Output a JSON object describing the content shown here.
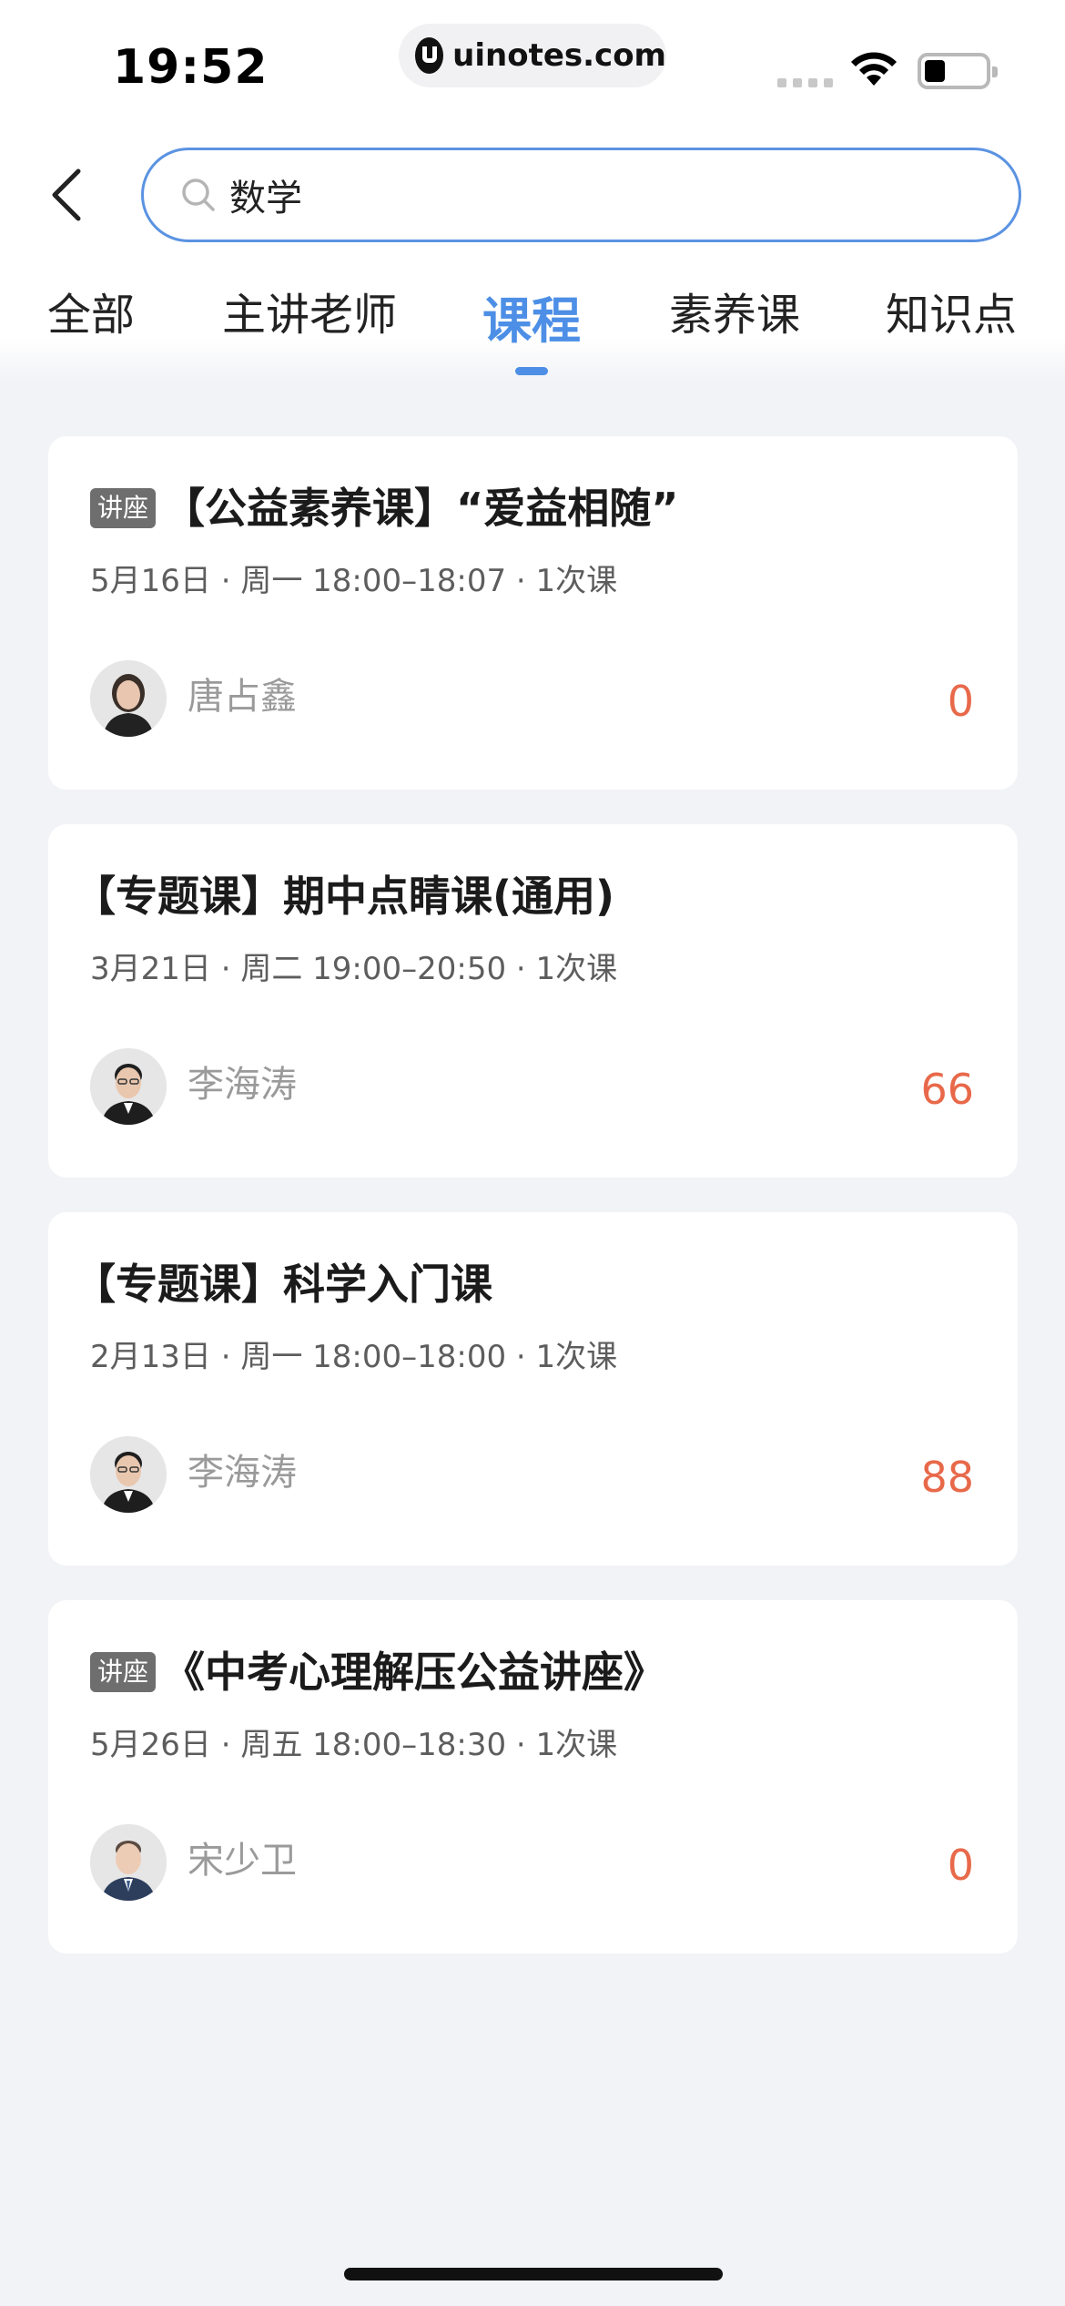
{
  "status_bar": {
    "time": "19:52",
    "url": "uinotes.com"
  },
  "search": {
    "value": "数学"
  },
  "tabs": [
    {
      "label": "全部",
      "active": false
    },
    {
      "label": "主讲老师",
      "active": false
    },
    {
      "label": "课程",
      "active": true
    },
    {
      "label": "素养课",
      "active": false
    },
    {
      "label": "知识点",
      "active": false
    }
  ],
  "courses": [
    {
      "badge": "讲座",
      "title": "【公益素养课】“爱益相随”",
      "meta": "5月16日 · 周一 18:00–18:07 · 1次课",
      "teacher": "唐占鑫",
      "count": "0"
    },
    {
      "badge": "",
      "title": "【专题课】期中点睛课(通用)",
      "meta": "3月21日 · 周二 19:00–20:50 · 1次课",
      "teacher": "李海涛",
      "count": "66"
    },
    {
      "badge": "",
      "title": "【专题课】科学入门课",
      "meta": "2月13日 · 周一 18:00–18:00 · 1次课",
      "teacher": "李海涛",
      "count": "88"
    },
    {
      "badge": "讲座",
      "title": "《中考心理解压公益讲座》",
      "meta": "5月26日 · 周五 18:00–18:30 · 1次课",
      "teacher": "宋少卫",
      "count": "0"
    }
  ],
  "colors": {
    "accent": "#4d8fe6",
    "count": "#e8694a",
    "background": "#f2f3f6"
  }
}
